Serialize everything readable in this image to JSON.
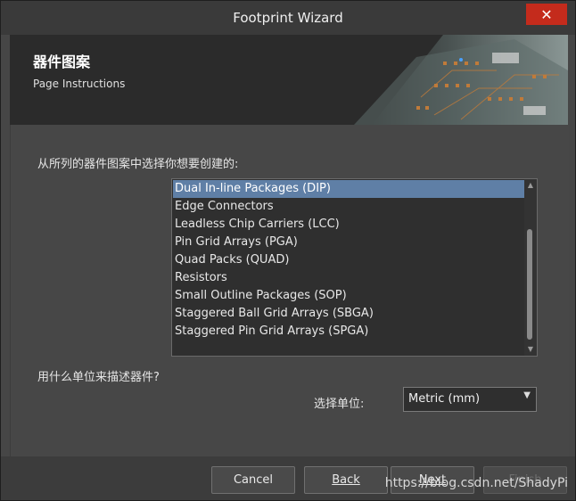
{
  "window": {
    "title": "Footprint Wizard",
    "close_glyph": "✕"
  },
  "banner": {
    "title": "器件图案",
    "subtitle": "Page Instructions"
  },
  "content": {
    "prompt1": "从所列的器件图案中选择你想要创建的:",
    "list_items": [
      "Dual In-line Packages (DIP)",
      "Edge Connectors",
      "Leadless Chip Carriers (LCC)",
      "Pin Grid Arrays (PGA)",
      "Quad Packs (QUAD)",
      "Resistors",
      "Small Outline Packages (SOP)",
      "Staggered Ball Grid Arrays (SBGA)",
      "Staggered Pin Grid Arrays (SPGA)"
    ],
    "selected_item": "Dual In-line Packages (DIP)",
    "prompt2": "用什么单位来描述器件?",
    "unit_label": "选择单位:",
    "unit_value": "Metric (mm)"
  },
  "footer": {
    "cancel_label": "Cancel",
    "back_label": "Back",
    "next_label": "Next",
    "finish_label": "Finish",
    "watermark": "https://blog.csdn.net/ShadyPi"
  }
}
